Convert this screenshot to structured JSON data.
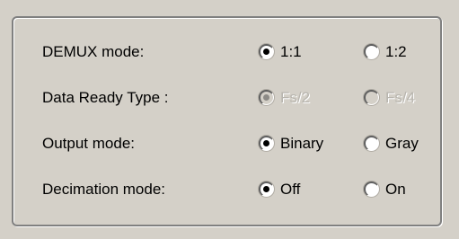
{
  "rows": [
    {
      "label": "DEMUX mode:",
      "options": [
        {
          "label": "1:1",
          "checked": true,
          "enabled": true
        },
        {
          "label": "1:2",
          "checked": false,
          "enabled": true
        }
      ]
    },
    {
      "label": "Data Ready Type :",
      "options": [
        {
          "label": "Fs/2",
          "checked": true,
          "enabled": false
        },
        {
          "label": "Fs/4",
          "checked": false,
          "enabled": false
        }
      ]
    },
    {
      "label": "Output mode:",
      "options": [
        {
          "label": "Binary",
          "checked": true,
          "enabled": true
        },
        {
          "label": "Gray",
          "checked": false,
          "enabled": true
        }
      ]
    },
    {
      "label": "Decimation mode:",
      "options": [
        {
          "label": "Off",
          "checked": true,
          "enabled": true
        },
        {
          "label": "On",
          "checked": false,
          "enabled": true
        }
      ]
    }
  ],
  "colors": {
    "background": "#d4d0c8",
    "disabled_text": "#b8b5ae"
  }
}
